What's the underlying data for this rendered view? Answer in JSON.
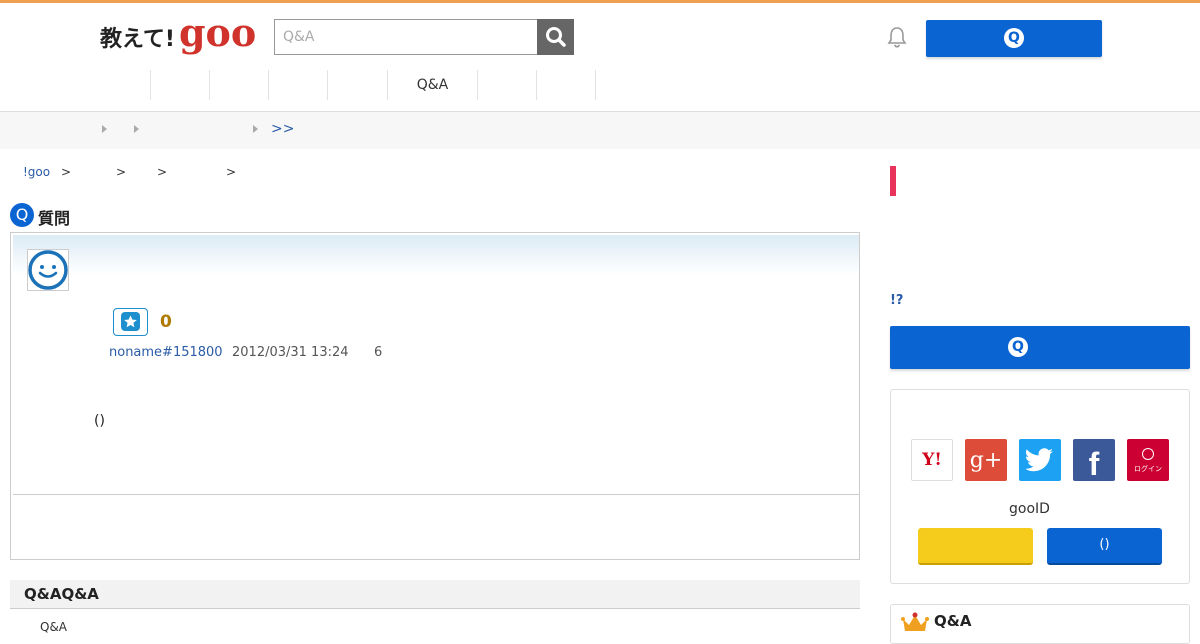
{
  "colors": {
    "accent": "#0a64d2",
    "brand_red": "#d0332b",
    "pink": "#e8345c",
    "gold": "#b07a00"
  },
  "header": {
    "logo_jp": "教えて!",
    "logo_goo": "goo",
    "search_placeholder": "Q&A",
    "search_icon": "search-icon",
    "bell_icon": "bell-icon",
    "ask_button_icon": "Q"
  },
  "nav": {
    "items": [
      {
        "label": ""
      },
      {
        "label": ""
      },
      {
        "label": ""
      },
      {
        "label": ""
      },
      {
        "label": ""
      },
      {
        "label": "Q&A"
      },
      {
        "label": ""
      },
      {
        "label": ""
      }
    ]
  },
  "subnav": {
    "more": ">>"
  },
  "breadcrumb": {
    "home": "!goo",
    "sep1": ">",
    "sep2": ">",
    "sep3": ">",
    "sep4": ">"
  },
  "question": {
    "heading_icon": "Q",
    "heading": "質問",
    "star_count": "0",
    "user": "noname#151800",
    "datetime": "2012/03/31 13:24",
    "count": "6",
    "body": "()"
  },
  "related": {
    "title": "Q&AQ&A",
    "first_item": "Q&A"
  },
  "sidebar": {
    "link": "!?",
    "ask_icon": "Q",
    "login": {
      "sns": [
        {
          "name": "yahoo",
          "label": "Y!",
          "color": "#ffffff"
        },
        {
          "name": "google-plus",
          "label": "g+",
          "color": "#dd4b39"
        },
        {
          "name": "twitter",
          "label": "",
          "color": "#1da1f2"
        },
        {
          "name": "facebook",
          "label": "f",
          "color": "#3b5998"
        },
        {
          "name": "docomo",
          "label": "ログイン",
          "color": "#cc0033"
        }
      ],
      "gooid": "gooID",
      "blue_button": "()"
    },
    "ranking_title": "Q&A"
  }
}
